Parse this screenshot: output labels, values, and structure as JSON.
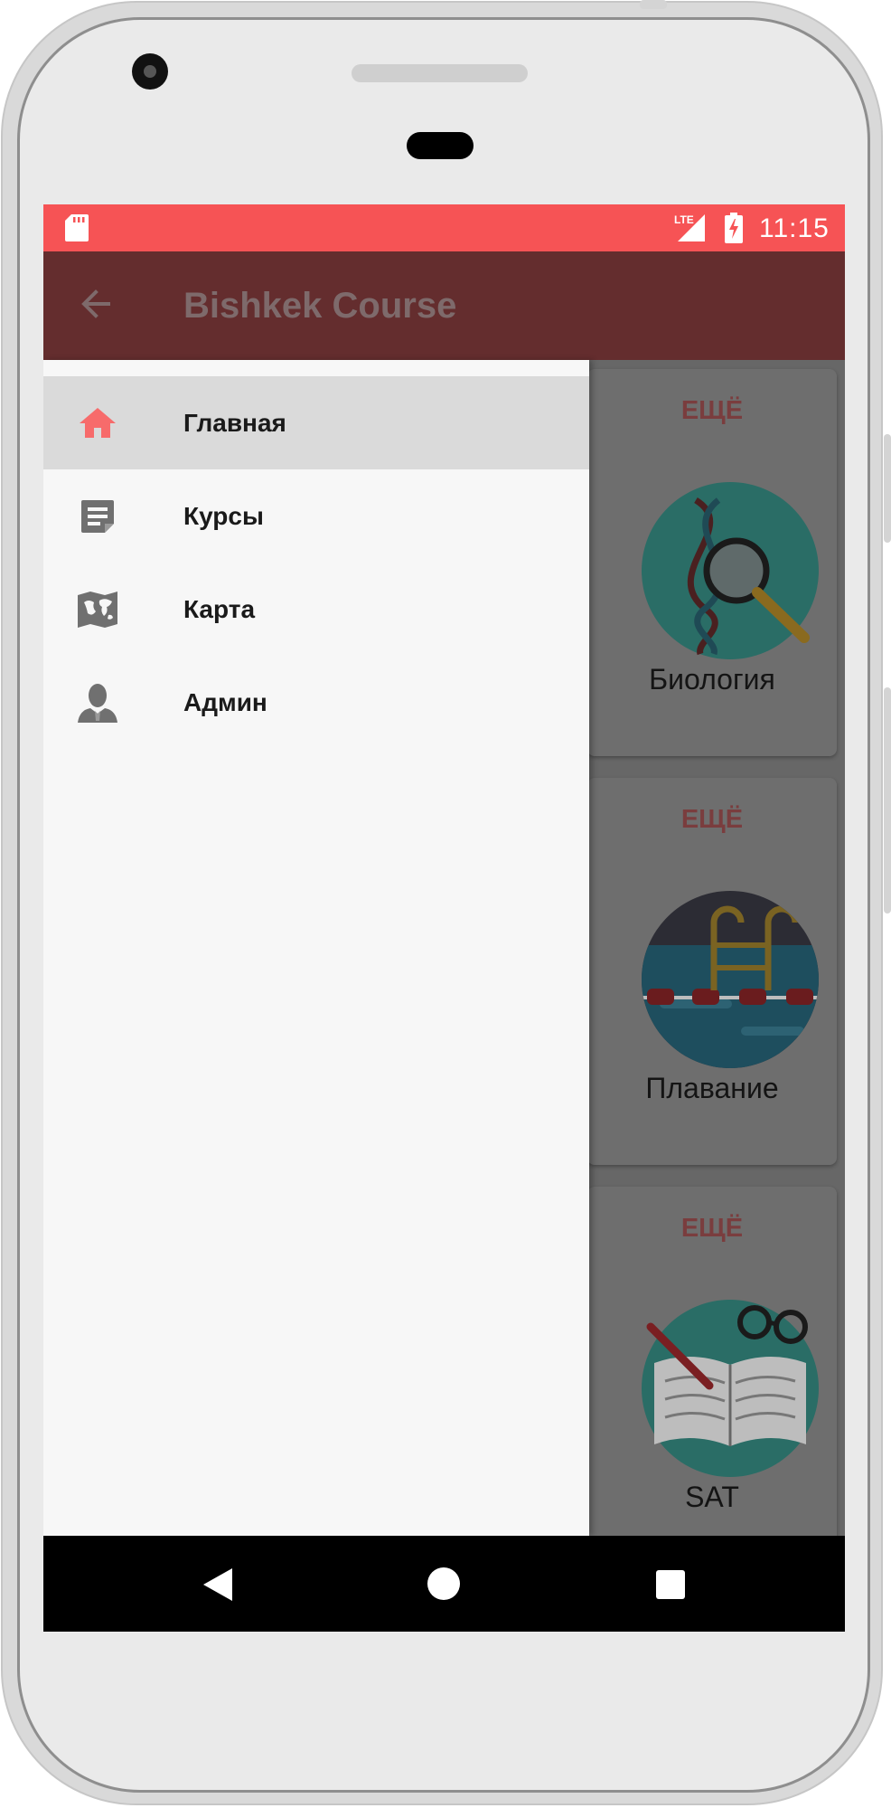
{
  "status_bar": {
    "time": "11:15",
    "network": "LTE",
    "color": "#f65355",
    "icons": [
      "sd-card-icon",
      "lte-signal-icon",
      "battery-charging-icon"
    ]
  },
  "app_bar": {
    "title": "Bishkek Course",
    "back_icon": "arrow-left-icon",
    "color": "#642d2e"
  },
  "drawer": {
    "items": [
      {
        "label": "Главная",
        "icon": "home-icon",
        "selected": true
      },
      {
        "label": "Курсы",
        "icon": "note-icon",
        "selected": false
      },
      {
        "label": "Карта",
        "icon": "map-icon",
        "selected": false
      },
      {
        "label": "Админ",
        "icon": "person-icon",
        "selected": false
      }
    ],
    "accent": "#f76b6b"
  },
  "cards": [
    {
      "more": "ЕЩЁ",
      "label": "Биология",
      "image": "biology-dna-magnifier-image"
    },
    {
      "more": "ЕЩЁ",
      "label": "Плавание",
      "image": "swimming-pool-image"
    },
    {
      "more": "ЕЩЁ",
      "label": "SAT",
      "image": "book-glasses-image"
    }
  ],
  "nav_bar": {
    "icons": [
      "nav-back-icon",
      "nav-home-icon",
      "nav-recent-icon"
    ]
  }
}
